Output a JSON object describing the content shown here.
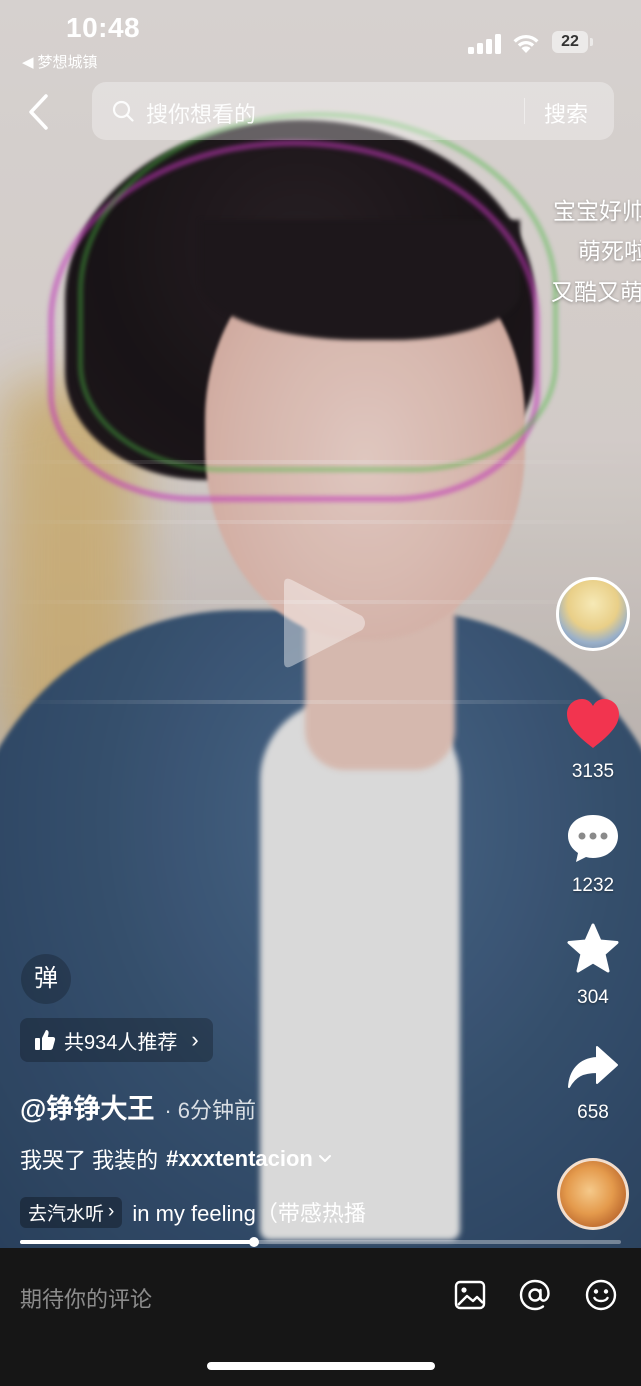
{
  "status_bar": {
    "time": "10:48",
    "back_app": "梦想城镇",
    "battery": "22"
  },
  "search": {
    "placeholder": "搜你想看的",
    "button": "搜索"
  },
  "danmaku": [
    "宝宝好帅",
    "萌死啦",
    "又酷又萌"
  ],
  "rail": {
    "likes": "3135",
    "comments": "1232",
    "favorites": "304",
    "shares": "658",
    "like_color": "#f2344f"
  },
  "info": {
    "danmaku_toggle": "弹",
    "recommend": "共934人推荐",
    "author": "@铮铮大王",
    "time_ago": "· 6分钟前",
    "caption": "我哭了 我装的",
    "hashtag": "#xxxtentacion",
    "music_chip": "去汽水听",
    "music_title": "in my feeling（带感热播"
  },
  "progress": {
    "fraction": 0.39
  },
  "bottom": {
    "comment_placeholder": "期待你的评论"
  },
  "icons": {
    "back": "chevron-left-icon",
    "search": "search-icon",
    "like": "heart-icon",
    "comment": "comment-bubble-icon",
    "favorite": "star-icon",
    "share": "share-arrow-icon",
    "image": "image-icon",
    "mention": "at-icon",
    "emoji": "emoji-icon"
  }
}
